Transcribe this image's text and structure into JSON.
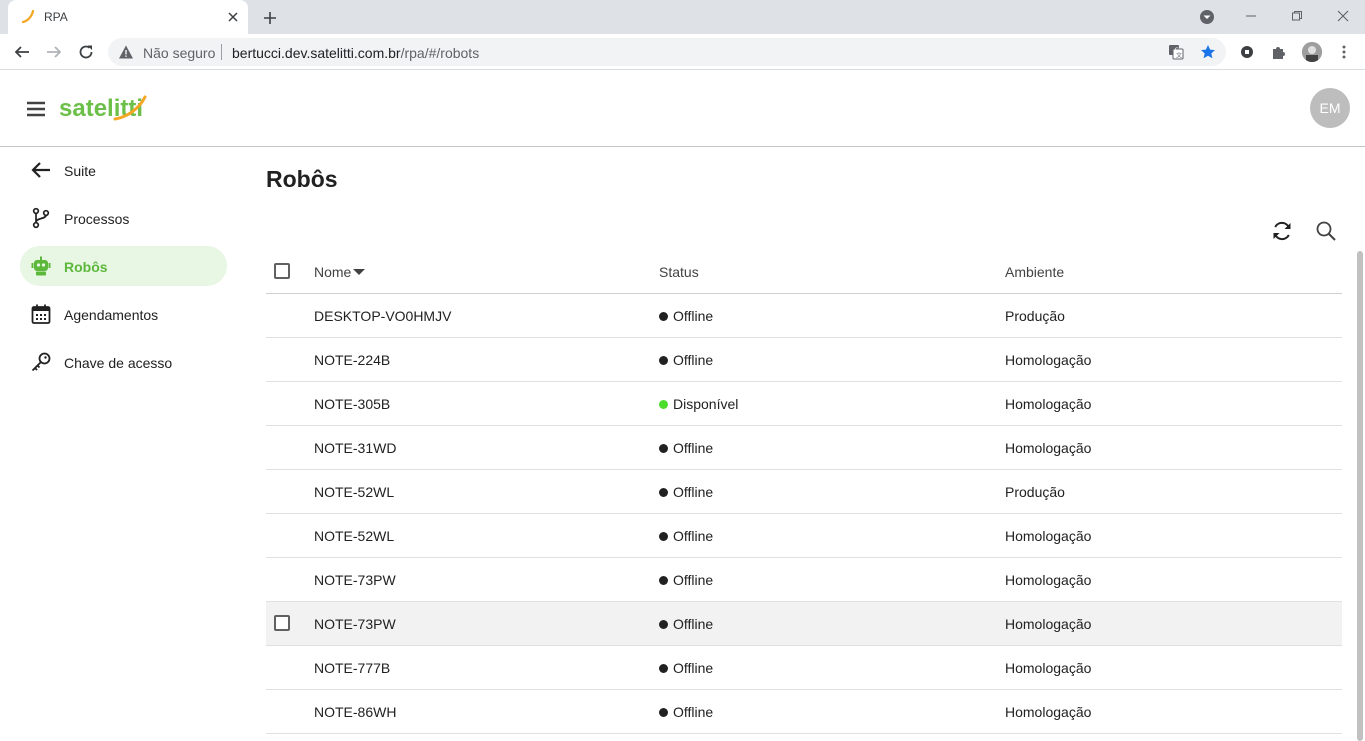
{
  "browser": {
    "tab_title": "RPA",
    "security_text": "Não seguro",
    "url_host": "bertucci.dev.satelitti.com.br",
    "url_path": "/rpa/#/robots"
  },
  "header": {
    "logo_text": "satelitti",
    "user_initials": "EM"
  },
  "sidebar": {
    "items": [
      {
        "label": "Suite",
        "icon": "arrow-back-icon"
      },
      {
        "label": "Processos",
        "icon": "process-branch-icon"
      },
      {
        "label": "Robôs",
        "icon": "robot-icon",
        "active": true
      },
      {
        "label": "Agendamentos",
        "icon": "calendar-icon"
      },
      {
        "label": "Chave de acesso",
        "icon": "key-icon"
      }
    ]
  },
  "main": {
    "title": "Robôs",
    "actions": {
      "refresh": "refresh-icon",
      "search": "search-icon"
    },
    "table": {
      "columns": {
        "name": "Nome",
        "status": "Status",
        "environment": "Ambiente"
      },
      "rows": [
        {
          "name": "DESKTOP-VO0HMJV",
          "status": "Offline",
          "status_color": "#212121",
          "environment": "Produção"
        },
        {
          "name": "NOTE-224B",
          "status": "Offline",
          "status_color": "#212121",
          "environment": "Homologação"
        },
        {
          "name": "NOTE-305B",
          "status": "Disponível",
          "status_color": "#4cdc2c",
          "environment": "Homologação"
        },
        {
          "name": "NOTE-31WD",
          "status": "Offline",
          "status_color": "#212121",
          "environment": "Homologação"
        },
        {
          "name": "NOTE-52WL",
          "status": "Offline",
          "status_color": "#212121",
          "environment": "Produção"
        },
        {
          "name": "NOTE-52WL",
          "status": "Offline",
          "status_color": "#212121",
          "environment": "Homologação"
        },
        {
          "name": "NOTE-73PW",
          "status": "Offline",
          "status_color": "#212121",
          "environment": "Homologação"
        },
        {
          "name": "NOTE-73PW",
          "status": "Offline",
          "status_color": "#212121",
          "environment": "Homologação",
          "hover": true
        },
        {
          "name": "NOTE-777B",
          "status": "Offline",
          "status_color": "#212121",
          "environment": "Homologação"
        },
        {
          "name": "NOTE-86WH",
          "status": "Offline",
          "status_color": "#212121",
          "environment": "Homologação"
        }
      ]
    }
  },
  "colors": {
    "brand": "#6cc04a",
    "active_bg": "#e8f6e4",
    "online": "#4cdc2c"
  }
}
